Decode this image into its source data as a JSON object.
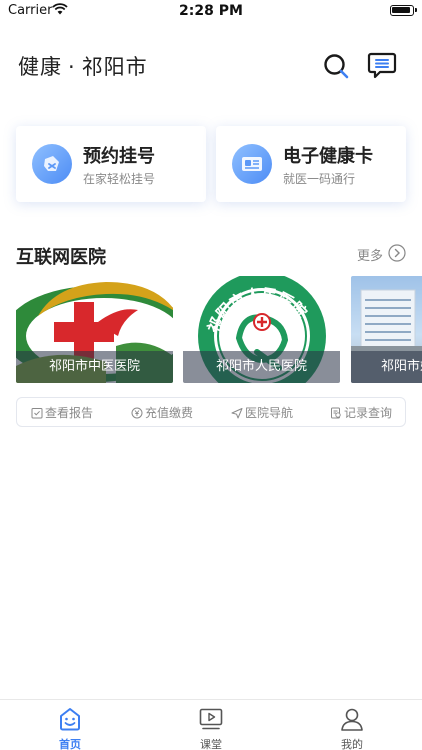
{
  "status_bar": {
    "carrier": "Carrier",
    "time": "2:28 PM"
  },
  "header": {
    "title_prefix": "健康",
    "separator": "·",
    "city": "祁阳市"
  },
  "quick_cards": [
    {
      "title": "预约挂号",
      "subtitle": "在家轻松挂号",
      "icon": "ticket-icon"
    },
    {
      "title": "电子健康卡",
      "subtitle": "就医一码通行",
      "icon": "health-card-icon"
    }
  ],
  "section": {
    "title": "互联网医院",
    "more_label": "更多"
  },
  "hospitals": [
    {
      "name": "祁阳市中医医院"
    },
    {
      "name": "祁阳市人民医院"
    },
    {
      "name": "祁阳市妇"
    }
  ],
  "logo_text": {
    "seal": "祁阳市人民医院"
  },
  "functions": [
    {
      "label": "查看报告",
      "icon": "report-icon"
    },
    {
      "label": "充值缴费",
      "icon": "yen-icon"
    },
    {
      "label": "医院导航",
      "icon": "navigation-icon"
    },
    {
      "label": "记录查询",
      "icon": "record-icon"
    }
  ],
  "tabs": [
    {
      "label": "首页",
      "active": true
    },
    {
      "label": "课堂",
      "active": false
    },
    {
      "label": "我的",
      "active": false
    }
  ],
  "colors": {
    "accent": "#3d7ff2",
    "text": "#222222",
    "muted": "#8a8a8a"
  }
}
